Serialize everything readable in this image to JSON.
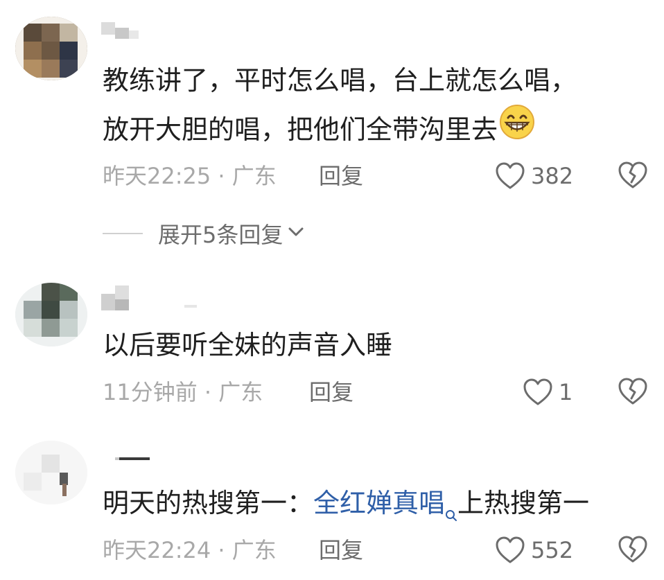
{
  "comments": [
    {
      "text_lines": [
        "教练讲了，平时怎么唱，台上就怎么唱，",
        "放开大胆的唱，把他们全带沟里去"
      ],
      "emoji": "grinning-face-emoji",
      "time": "昨天22:25",
      "location": "广东",
      "separator": "·",
      "reply_label": "回复",
      "likes": "382",
      "expand_label": "展开5条回复"
    },
    {
      "text_lines": [
        "以后要听全妹的声音入睡"
      ],
      "time": "11分钟前",
      "location": "广东",
      "separator": "·",
      "reply_label": "回复",
      "likes": "1"
    },
    {
      "text_prefix": "明天的热搜第一：",
      "text_link": "全红婵真唱",
      "text_suffix": "上热搜第一",
      "time": "昨天22:24",
      "location": "广东",
      "separator": "·",
      "reply_label": "回复",
      "likes": "552"
    }
  ],
  "icons": {
    "like": "heart-outline-icon",
    "dislike": "broken-heart-icon",
    "expand": "chevron-down-icon",
    "link_search": "search-icon"
  },
  "colors": {
    "text": "#1f1f1f",
    "meta": "#a8a8a8",
    "secondary": "#6c6c6c",
    "link": "#2f5fa8"
  }
}
